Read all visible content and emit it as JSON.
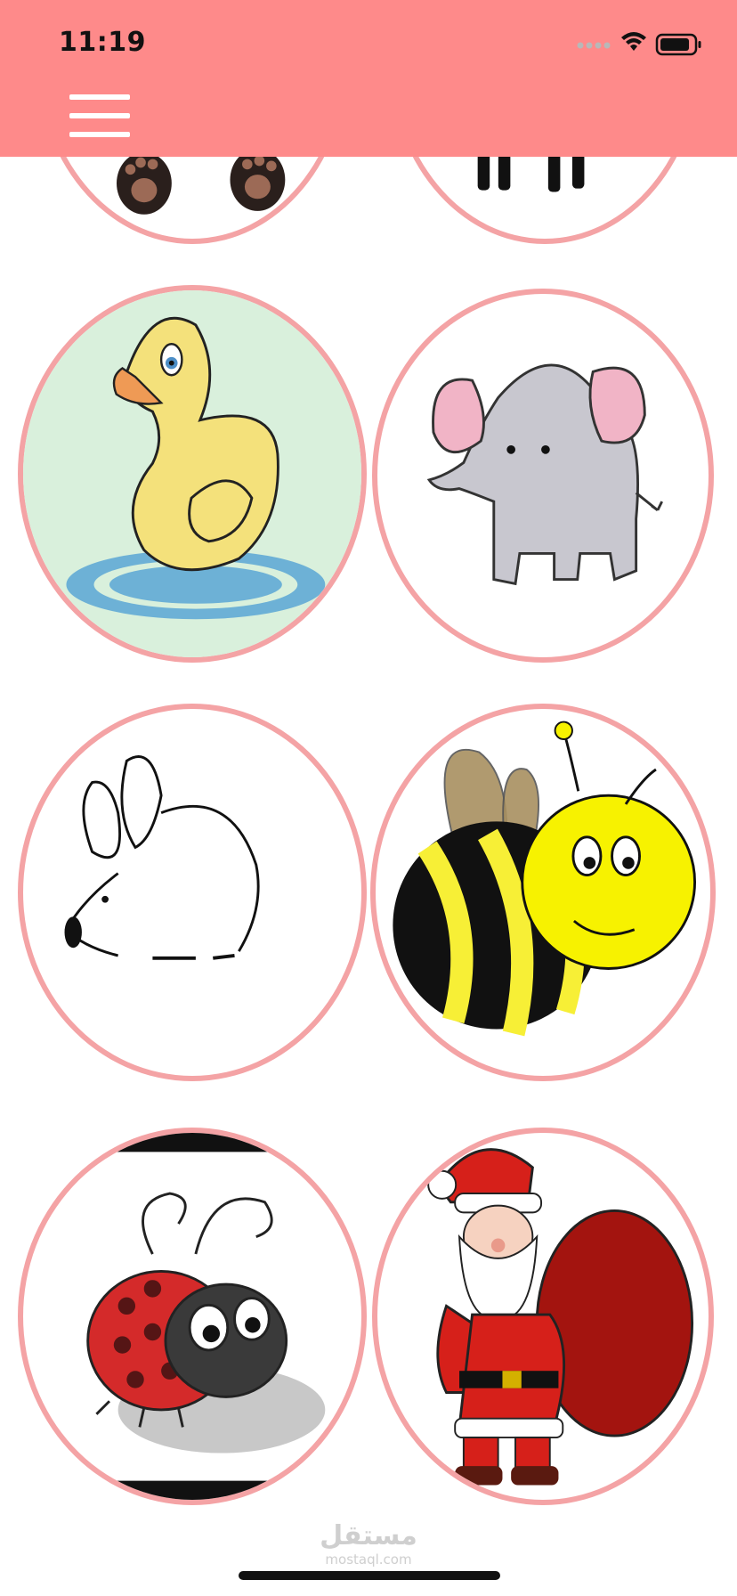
{
  "status_bar": {
    "time": "11:19",
    "icons": [
      "signal-icon",
      "wifi-icon",
      "battery-icon"
    ]
  },
  "header": {
    "background_color": "#fe8a8a",
    "menu_icon": "hamburger-menu-icon"
  },
  "grid": {
    "border_color": "#f4a3a5",
    "items": [
      {
        "subject": "panda"
      },
      {
        "subject": "zebra"
      },
      {
        "subject": "duck"
      },
      {
        "subject": "elephant"
      },
      {
        "subject": "mouse"
      },
      {
        "subject": "bee"
      },
      {
        "subject": "ladybug"
      },
      {
        "subject": "santa-claus"
      }
    ]
  },
  "watermark": {
    "arabic": "مستقل",
    "latin": "mostaql.com"
  }
}
